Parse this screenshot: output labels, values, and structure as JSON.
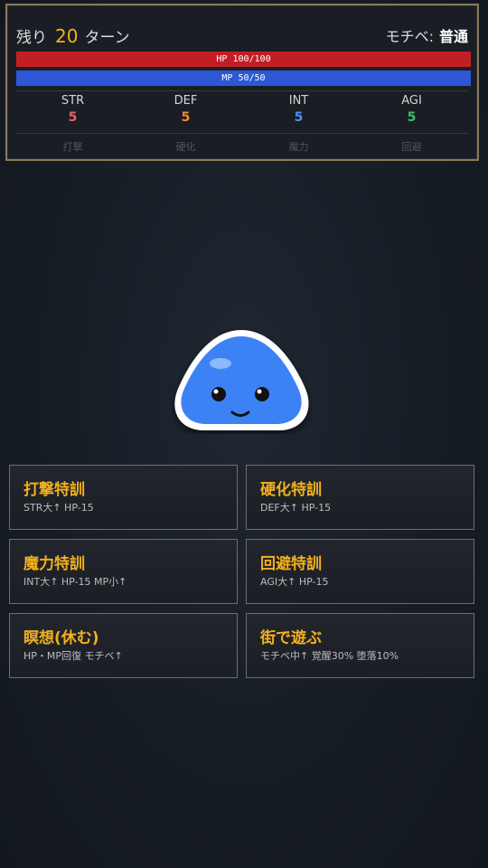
{
  "status": {
    "turns_prefix": "残り",
    "turns_value": "20",
    "turns_suffix": "ターン",
    "mood_label": "モチベ:",
    "mood_value": "普通",
    "hp_text": "HP 100/100",
    "hp_ratio": 1.0,
    "mp_text": "MP 50/50",
    "mp_ratio": 1.0,
    "stats": [
      {
        "name": "STR",
        "value": "5",
        "color": "#f06060",
        "desc": "打撃"
      },
      {
        "name": "DEF",
        "value": "5",
        "color": "#f28a33",
        "desc": "硬化"
      },
      {
        "name": "INT",
        "value": "5",
        "color": "#4a8ff0",
        "desc": "魔力"
      },
      {
        "name": "AGI",
        "value": "5",
        "color": "#34c06a",
        "desc": "回避"
      }
    ]
  },
  "character": {
    "color": "#3d82f5"
  },
  "actions": [
    {
      "title": "打撃特訓",
      "sub": "STR大↑ HP-15"
    },
    {
      "title": "硬化特訓",
      "sub": "DEF大↑ HP-15"
    },
    {
      "title": "魔力特訓",
      "sub": "INT大↑ HP-15 MP小↑"
    },
    {
      "title": "回避特訓",
      "sub": "AGI大↑ HP-15"
    },
    {
      "title": "瞑想(休む)",
      "sub": "HP・MP回復 モチベ↑"
    },
    {
      "title": "街で遊ぶ",
      "sub": "モチベ中↑ 覚醒30% 堕落10%"
    }
  ]
}
